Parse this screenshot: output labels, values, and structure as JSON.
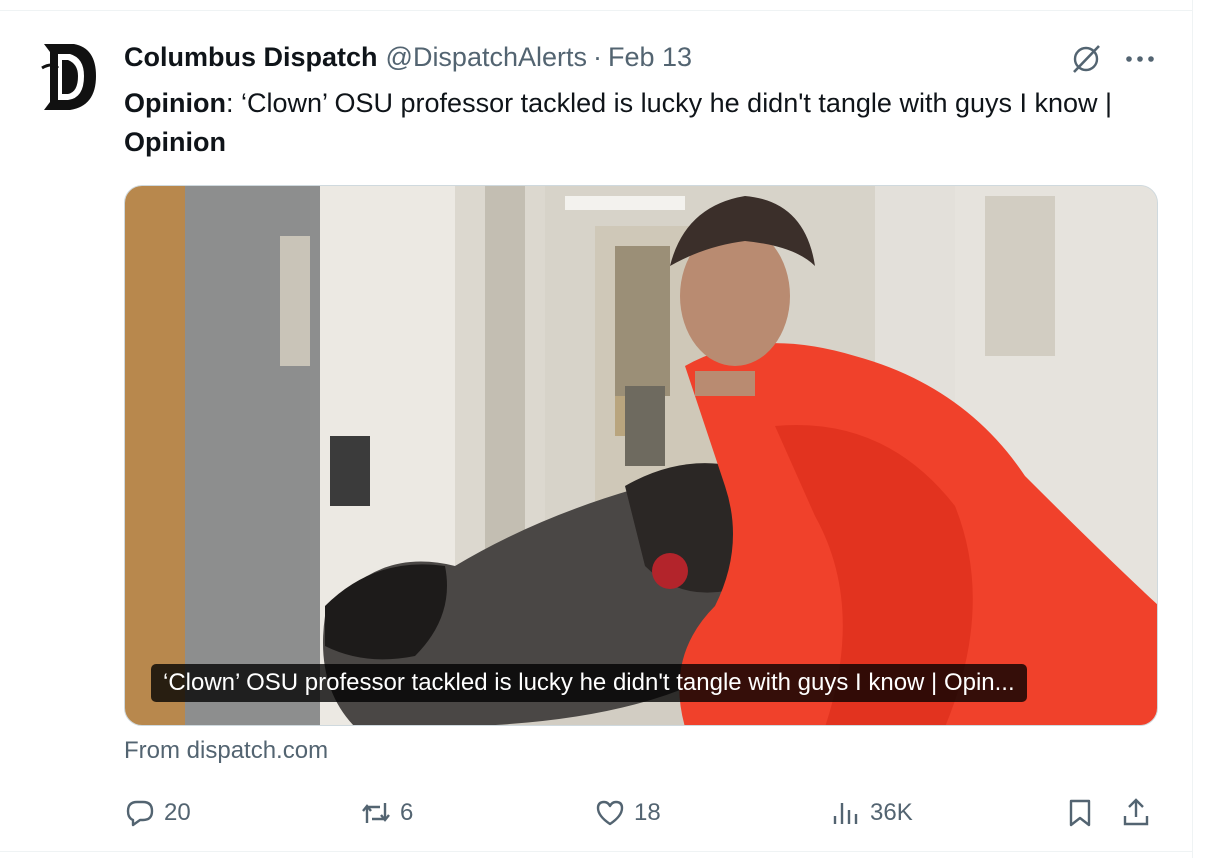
{
  "tweet": {
    "display_name": "Columbus Dispatch",
    "handle": "@DispatchAlerts",
    "separator": "·",
    "date": "Feb 13",
    "text_bold_prefix": "Opinion",
    "text_main": ": ‘Clown’ OSU professor tackled is lucky he didn't tangle with guys I know | ",
    "text_bold_suffix": "Opinion"
  },
  "card": {
    "caption": "‘Clown’ OSU professor tackled is lucky he didn't tangle with guys I know | Opin...",
    "source": "From dispatch.com"
  },
  "actions": {
    "replies": "20",
    "reposts": "6",
    "likes": "18",
    "views": "36K"
  },
  "icons": {
    "avatar": "columbus-dispatch-logo",
    "grok": "grok-icon",
    "more": "more-icon",
    "reply": "reply-icon",
    "repost": "repost-icon",
    "like": "heart-icon",
    "views": "views-icon",
    "bookmark": "bookmark-icon",
    "share": "share-icon"
  },
  "colors": {
    "text_primary": "#0f1419",
    "text_secondary": "#536471",
    "border": "#cfd9de"
  }
}
